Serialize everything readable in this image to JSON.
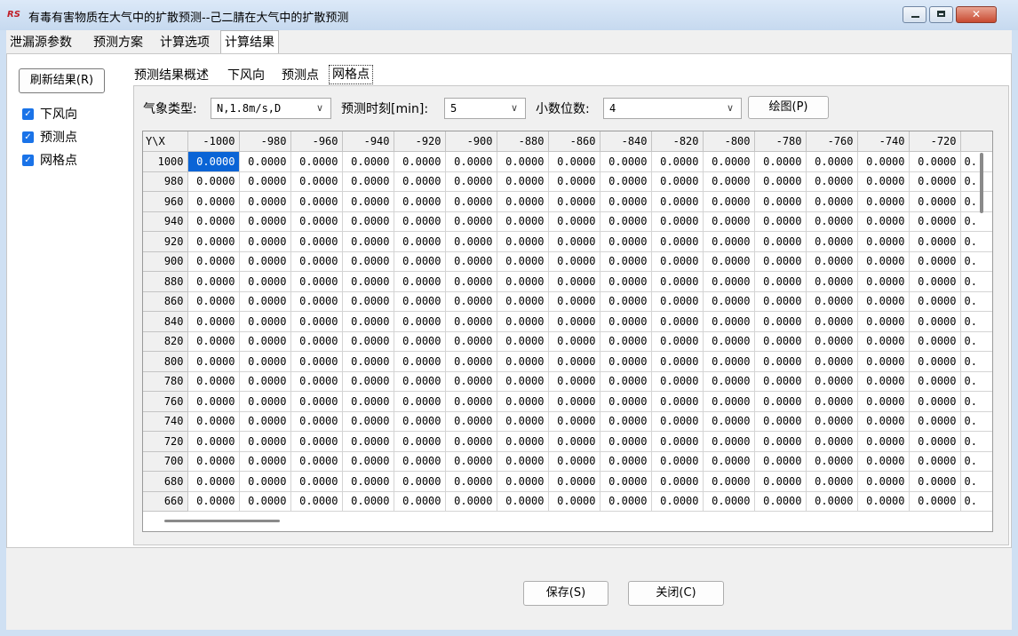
{
  "window": {
    "title": "有毒有害物质在大气中的扩散预测--己二腈在大气中的扩散预测",
    "app_icon": "RS",
    "close_label": "✕"
  },
  "main_tabs": [
    "泄漏源参数",
    "预测方案",
    "计算选项",
    "计算结果"
  ],
  "active_main_tab": "计算结果",
  "refresh_button": "刷新结果(R)",
  "checkboxes": [
    {
      "label": "下风向",
      "checked": true
    },
    {
      "label": "预测点",
      "checked": true
    },
    {
      "label": "网格点",
      "checked": true
    }
  ],
  "sub_tabs": [
    "预测结果概述",
    "下风向",
    "预测点",
    "网格点"
  ],
  "active_sub_tab": "网格点",
  "controls": {
    "weather_label": "气象类型:",
    "weather_value": "N,1.8m/s,D",
    "time_label": "预测时刻[min]:",
    "time_value": "5",
    "decimals_label": "小数位数:",
    "decimals_value": "4",
    "plot_button": "绘图(P)"
  },
  "grid": {
    "corner": "Y\\X",
    "columns": [
      "-1000",
      "-980",
      "-960",
      "-940",
      "-920",
      "-900",
      "-880",
      "-860",
      "-840",
      "-820",
      "-800",
      "-780",
      "-760",
      "-740",
      "-720",
      ""
    ],
    "rows": [
      "1000",
      "980",
      "960",
      "940",
      "920",
      "900",
      "880",
      "860",
      "840",
      "820",
      "800",
      "780",
      "760",
      "740",
      "720",
      "700",
      "680",
      "660"
    ],
    "cell_value": "0.0000",
    "partial_cell_value": "0."
  },
  "footer": {
    "save_button": "保存(S)",
    "close_button": "关闭(C)"
  },
  "colors": {
    "selection": "#0a64d6",
    "checkbox": "#1a73e8",
    "frame": "#cfe0f3"
  }
}
